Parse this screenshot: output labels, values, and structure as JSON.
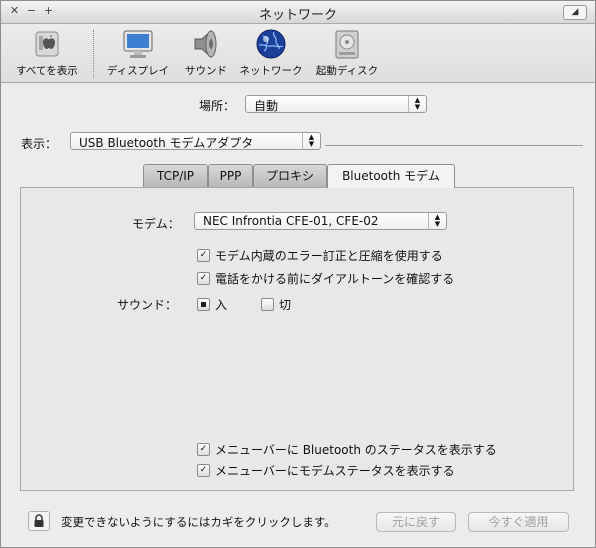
{
  "window": {
    "title": "ネットワーク",
    "controls": [
      "✕",
      "−",
      "+"
    ],
    "toolbar_toggle": "◢"
  },
  "toolbar": {
    "items": [
      {
        "label": "すべてを表示",
        "icon": "apple-show-all-icon"
      },
      {
        "label": "ディスプレイ",
        "icon": "display-icon"
      },
      {
        "label": "サウンド",
        "icon": "speaker-icon"
      },
      {
        "label": "ネットワーク",
        "icon": "globe-icon"
      },
      {
        "label": "起動ディスク",
        "icon": "hard-disk-icon"
      }
    ]
  },
  "location": {
    "label": "場所：",
    "value": "自動"
  },
  "show": {
    "label": "表示：",
    "value": "USB Bluetooth モデムアダプタ"
  },
  "tabs": [
    {
      "label": "TCP/IP",
      "active": false
    },
    {
      "label": "PPP",
      "active": false
    },
    {
      "label": "プロキシ",
      "active": false
    },
    {
      "label": "Bluetooth モデム",
      "active": true
    }
  ],
  "modem": {
    "label": "モデム：",
    "value": "NEC Infrontia CFE-01, CFE-02",
    "options": [
      {
        "label": "モデム内蔵のエラー訂正と圧縮を使用する",
        "checked": true
      },
      {
        "label": "電話をかける前にダイアルトーンを確認する",
        "checked": true
      }
    ],
    "sound": {
      "label": "サウンド：",
      "choices": [
        {
          "label": "入",
          "selected": true
        },
        {
          "label": "切",
          "selected": false
        }
      ]
    },
    "menubar_options": [
      {
        "label": "メニューバーに Bluetooth のステータスを表示する",
        "checked": true
      },
      {
        "label": "メニューバーにモデムステータスを表示する",
        "checked": true
      }
    ]
  },
  "footer": {
    "lock_text": "変更できないようにするにはカギをクリックします。",
    "revert_label": "元に戻す",
    "apply_label": "今すぐ適用"
  }
}
